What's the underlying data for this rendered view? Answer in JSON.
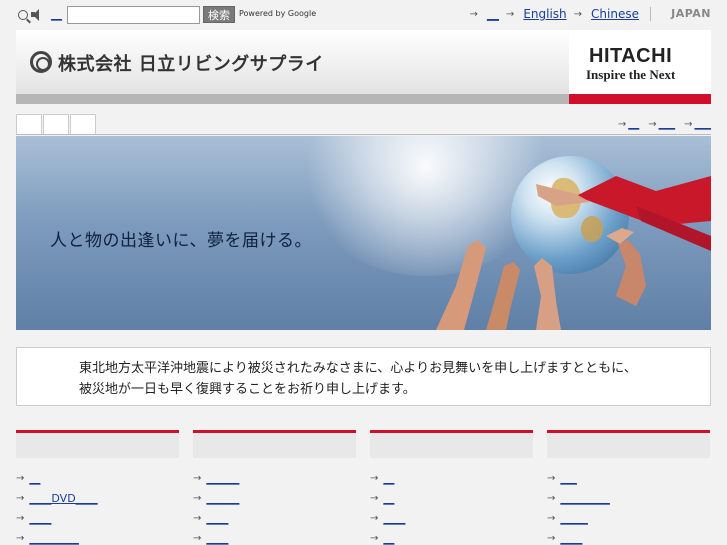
{
  "topbar": {
    "util_link": "__",
    "search_placeholder": "",
    "search_button": "検索",
    "powered_by": "Powered by Google",
    "links": [
      "__",
      "English",
      "Chinese"
    ],
    "region": "JAPAN"
  },
  "header": {
    "company_name": "株式会社 日立リビングサプライ",
    "brand_name": "HITACHI",
    "brand_tagline": "Inspire the Next"
  },
  "nav": {
    "tabs": [
      "",
      "",
      ""
    ],
    "links": [
      "__",
      "___",
      "___"
    ]
  },
  "hero": {
    "tagline": "人と物の出逢いに、夢を届ける。"
  },
  "notice": {
    "line1": "東北地方太平洋沖地震により被災されたみなさまに、心よりお見舞いを申し上げますとともに、",
    "line2": "被災地が一日も早く復興することをお祈り申し上げます。"
  },
  "columns": [
    {
      "heading": "",
      "links": [
        "__",
        "____DVD____",
        "____",
        "_________"
      ]
    },
    {
      "heading": "",
      "links": [
        "______",
        "______",
        "____",
        "____"
      ]
    },
    {
      "heading": "",
      "links": [
        "__",
        "__",
        "____",
        "__"
      ]
    },
    {
      "heading": "",
      "links": [
        "___",
        "_________",
        "_____",
        "____"
      ]
    }
  ],
  "colors": {
    "accent_red": "#d0102a",
    "link_blue": "#1a3d9a"
  }
}
